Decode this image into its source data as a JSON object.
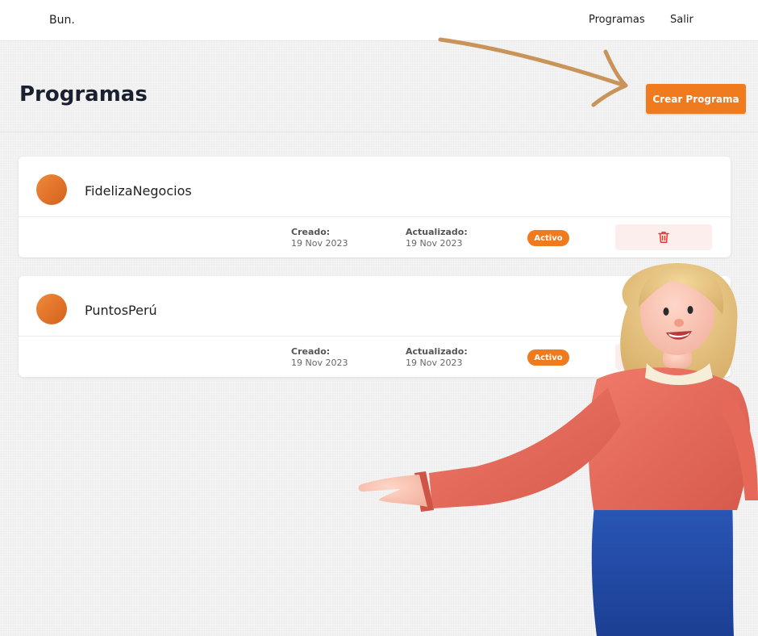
{
  "navbar": {
    "brand": "Bun.",
    "links": [
      "Programas",
      "Salir"
    ]
  },
  "page": {
    "title": "Programas",
    "create_button": "Crear Programa"
  },
  "programs": [
    {
      "name": "FidelizaNegocios",
      "created_label": "Creado:",
      "created": "19 Nov 2023",
      "updated_label": "Actualizado:",
      "updated": "19 Nov 2023",
      "status": "Activo"
    },
    {
      "name": "PuntosPerú",
      "created_label": "Creado:",
      "created": "19 Nov 2023",
      "updated_label": "Actualizado:",
      "updated": "19 Nov 2023",
      "status": "Activo"
    }
  ],
  "colors": {
    "accent": "#f07a1e",
    "delete_bg": "#fdeeee",
    "delete_icon": "#e53935"
  },
  "icons": {
    "delete": "trash-icon",
    "arrow": "hand-drawn-arrow",
    "avatar": "program-avatar"
  }
}
